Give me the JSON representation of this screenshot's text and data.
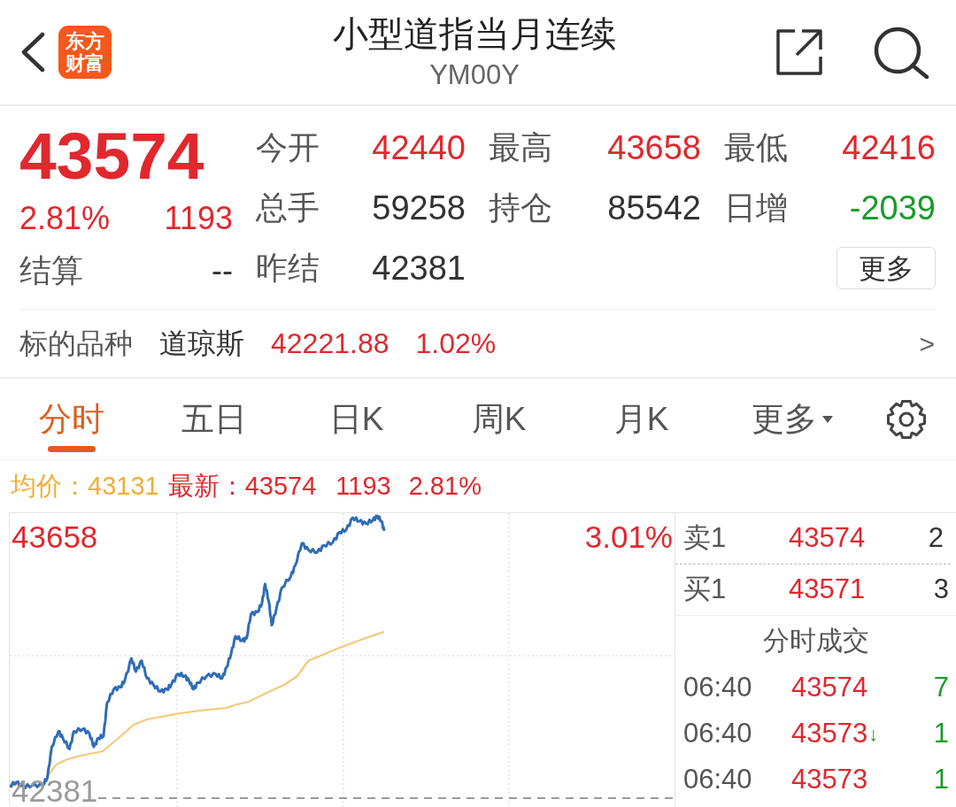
{
  "header": {
    "logo": [
      "东方",
      "财富"
    ],
    "title": "小型道指当月连续",
    "subtitle": "YM00Y"
  },
  "quote": {
    "price": "43574",
    "change_pct": "2.81%",
    "change": "1193",
    "settle_label": "结算",
    "settle_value": "--"
  },
  "stats": [
    {
      "label": "今开",
      "value": "42440",
      "color": "#e0282e"
    },
    {
      "label": "最高",
      "value": "43658",
      "color": "#e0282e"
    },
    {
      "label": "最低",
      "value": "42416",
      "color": "#e0282e"
    },
    {
      "label": "总手",
      "value": "59258",
      "color": "#333333"
    },
    {
      "label": "持仓",
      "value": "85542",
      "color": "#333333"
    },
    {
      "label": "日增",
      "value": "-2039",
      "color": "#1a9c2a"
    },
    {
      "label": "昨结",
      "value": "42381",
      "color": "#333333"
    }
  ],
  "more_button": "更多",
  "underlying": {
    "label": "标的品种",
    "name": "道琼斯",
    "price": "42221.88",
    "change_pct": "1.02%",
    "arrow": ">"
  },
  "tabs": [
    {
      "label": "分时",
      "selected": true,
      "kind": "tab"
    },
    {
      "label": "五日",
      "selected": false,
      "kind": "tab"
    },
    {
      "label": "日K",
      "selected": false,
      "kind": "tab"
    },
    {
      "label": "周K",
      "selected": false,
      "kind": "tab"
    },
    {
      "label": "月K",
      "selected": false,
      "kind": "tab"
    },
    {
      "label": "更多",
      "selected": false,
      "kind": "menu"
    }
  ],
  "summary": {
    "avg_label": "均价：",
    "avg_value": "43131",
    "last_label": "最新：",
    "last_value": "43574",
    "change": "1193",
    "change_pct": "2.81%"
  },
  "chart": {
    "top_label": "43658",
    "top_pct_label": "3.01%",
    "base_label": "42381"
  },
  "order_book": [
    {
      "label": "卖1",
      "price": "43574",
      "volume": "2"
    },
    {
      "label": "买1",
      "price": "43571",
      "volume": "3"
    }
  ],
  "trades_title": "分时成交",
  "trades": [
    {
      "time": "06:40",
      "price": "43574",
      "volume": "7",
      "color": "#1a9c2a"
    },
    {
      "time": "06:40",
      "price": "43573",
      "arrow": "↓",
      "volume": "1",
      "color": "#1a9c2a"
    },
    {
      "time": "06:40",
      "price": "43573",
      "volume": "1",
      "color": "#1a9c2a"
    }
  ]
}
